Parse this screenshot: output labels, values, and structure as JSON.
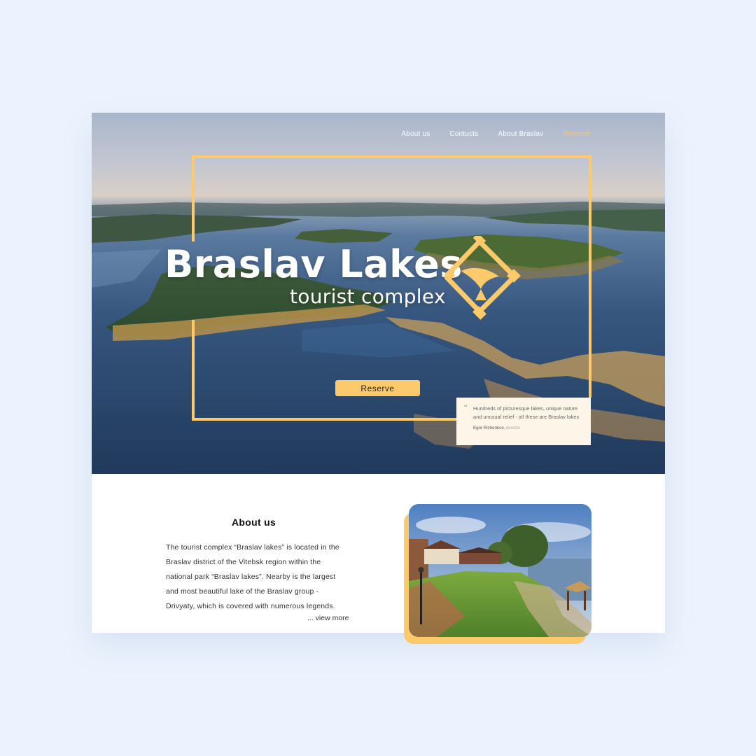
{
  "nav": {
    "items": [
      "About us",
      "Contucts",
      "About Braslav"
    ],
    "reserve": "Reserve"
  },
  "hero": {
    "title": "Braslav Lakes",
    "subtitle": "tourist complex",
    "reserve_button": "Reserve",
    "quote": {
      "text": "Hundreds of picturesque lakes, unique nature and unusual relief - all these are Braslav lakes",
      "author": "Egor Rizhenkov,",
      "role": "director"
    }
  },
  "about": {
    "title": "About us",
    "lines": [
      "The tourist complex “Braslav lakes” is located in the",
      "Braslav district of the Vitebsk region within the",
      "national park “Braslav lakes”. Nearby is the largest",
      "and most beautiful lake of the Braslav group -",
      "Drivyaty, which is covered with numerous legends."
    ],
    "view_more": "... view more"
  },
  "colors": {
    "accent": "#fcc96b",
    "page_bg": "#ecf3fe"
  },
  "icons": {
    "quote": "quote-mark-icon",
    "emblem": "emblem-icon"
  }
}
